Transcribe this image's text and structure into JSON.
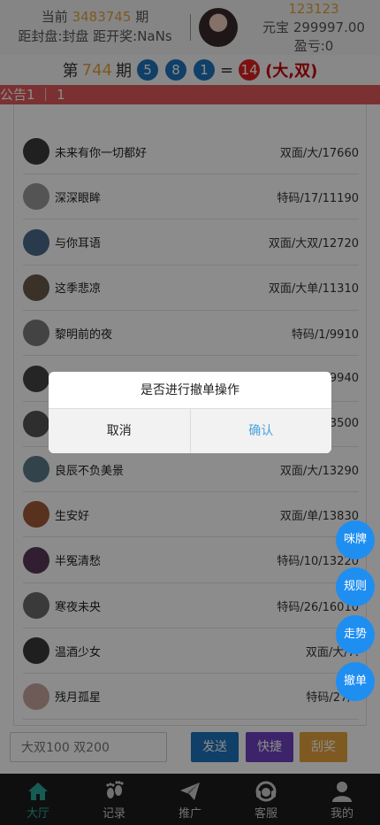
{
  "header": {
    "current_label": "当前",
    "current_period": "3483745",
    "period_unit": "期",
    "status_text": "距封盘:封盘 距开奖:NaNs",
    "user_id": "123123",
    "balance_text": "元宝 299997.00",
    "profit_text": "盈亏:0"
  },
  "period": {
    "prefix": "第",
    "number": "744",
    "suffix": "期",
    "balls": [
      "5",
      "8",
      "1"
    ],
    "equals": "=",
    "sum": "14",
    "result": "(大,双)"
  },
  "notice": {
    "text": "公告1 ｜ 1"
  },
  "rows": [
    {
      "name": "未来有你一切都好",
      "bet": "双面/大/17660",
      "av": "#3b3b3b"
    },
    {
      "name": "深深眼眸",
      "bet": "特码/17/11190",
      "av": "#9a9a9a"
    },
    {
      "name": "与你耳语",
      "bet": "双面/大双/12720",
      "av": "#4a6a8a"
    },
    {
      "name": "这季悲凉",
      "bet": "双面/大单/11310",
      "av": "#6b5a4a"
    },
    {
      "name": "黎明前的夜",
      "bet": "特码/1/9910",
      "av": "#7a7a7a"
    },
    {
      "name": "",
      "bet": "9940",
      "av": "#444"
    },
    {
      "name": "",
      "bet": "3500",
      "av": "#555"
    },
    {
      "name": "良辰不负美景",
      "bet": "双面/大/13290",
      "av": "#5b7b8b"
    },
    {
      "name": "生安好",
      "bet": "双面/单/13830",
      "av": "#a05a3a"
    },
    {
      "name": "半冤清愁",
      "bet": "特码/10/13220",
      "av": "#5a3a5a"
    },
    {
      "name": "寒夜未央",
      "bet": "特码/26/16010",
      "av": "#6a6a6a"
    },
    {
      "name": "温酒少女",
      "bet": "双面/大/7.",
      "av": "#3a3a3a"
    },
    {
      "name": "残月孤星",
      "bet": "特码/27/7",
      "av": "#c9a7a0"
    }
  ],
  "dialog": {
    "message": "是否进行撤单操作",
    "cancel": "取消",
    "confirm": "确认"
  },
  "floating": [
    "咪牌",
    "规则",
    "走势",
    "撤单"
  ],
  "input": {
    "value": "大双100 双200"
  },
  "actions": {
    "send": "发送",
    "quick": "快捷",
    "scratch": "刮奖"
  },
  "tabs": [
    "大厅",
    "记录",
    "推广",
    "客服",
    "我的"
  ],
  "colors": {
    "send": "#1e73be",
    "quick": "#6f42c1",
    "scratch": "#e6a23c",
    "float": "#1f8ef1",
    "active_tab": "#2aa89a"
  }
}
